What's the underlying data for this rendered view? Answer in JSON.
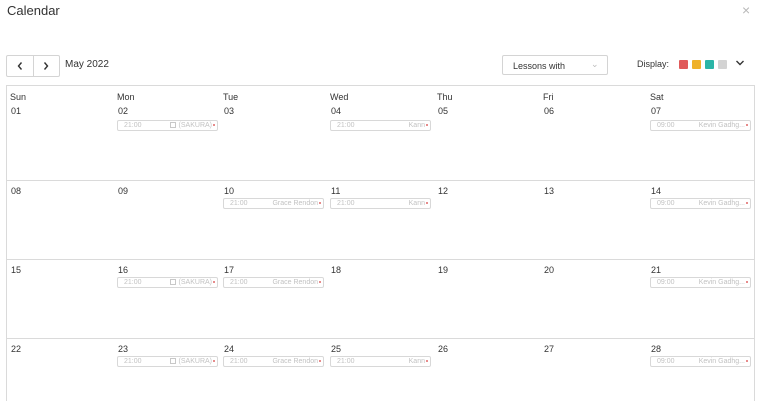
{
  "dialog": {
    "title": "Calendar",
    "close": "×"
  },
  "toolbar": {
    "month_label": "May 2022",
    "lessons_label": "Lessons with",
    "lessons_caret": "⌄",
    "display_label": "Display:",
    "swatches": [
      "#e05a5a",
      "#efb22a",
      "#2bb5a7",
      "#d3d3d3"
    ]
  },
  "weekdays": [
    "Sun",
    "Mon",
    "Tue",
    "Wed",
    "Thu",
    "Fri",
    "Sat"
  ],
  "weeks": [
    {
      "days": [
        "01",
        "02",
        "03",
        "04",
        "05",
        "06",
        "07"
      ],
      "lessons": [
        {
          "col": 1,
          "time": "21:00",
          "name": "(SAKURA)",
          "book": true
        },
        {
          "col": 3,
          "time": "21:00",
          "name": "Kann",
          "book": false
        },
        {
          "col": 6,
          "time": "09:00",
          "name": "Kevin Gadhg...",
          "book": false
        }
      ]
    },
    {
      "days": [
        "08",
        "09",
        "10",
        "11",
        "12",
        "13",
        "14"
      ],
      "lessons": [
        {
          "col": 2,
          "time": "21:00",
          "name": "Grace Rendon",
          "book": false
        },
        {
          "col": 3,
          "time": "21:00",
          "name": "Kann",
          "book": false
        },
        {
          "col": 6,
          "time": "09:00",
          "name": "Kevin Gadhg...",
          "book": false
        }
      ]
    },
    {
      "days": [
        "15",
        "16",
        "17",
        "18",
        "19",
        "20",
        "21"
      ],
      "lessons": [
        {
          "col": 1,
          "time": "21:00",
          "name": "(SAKURA)",
          "book": true
        },
        {
          "col": 2,
          "time": "21:00",
          "name": "Grace Rendon",
          "book": false
        },
        {
          "col": 6,
          "time": "09:00",
          "name": "Kevin Gadhg...",
          "book": false
        }
      ]
    },
    {
      "days": [
        "22",
        "23",
        "24",
        "25",
        "26",
        "27",
        "28"
      ],
      "lessons": [
        {
          "col": 1,
          "time": "21:00",
          "name": "(SAKURA)",
          "book": true
        },
        {
          "col": 2,
          "time": "21:00",
          "name": "Grace Rendon",
          "book": false
        },
        {
          "col": 3,
          "time": "21:00",
          "name": "Kann",
          "book": false
        },
        {
          "col": 6,
          "time": "09:00",
          "name": "Kevin Gadhg...",
          "book": false
        }
      ]
    }
  ]
}
